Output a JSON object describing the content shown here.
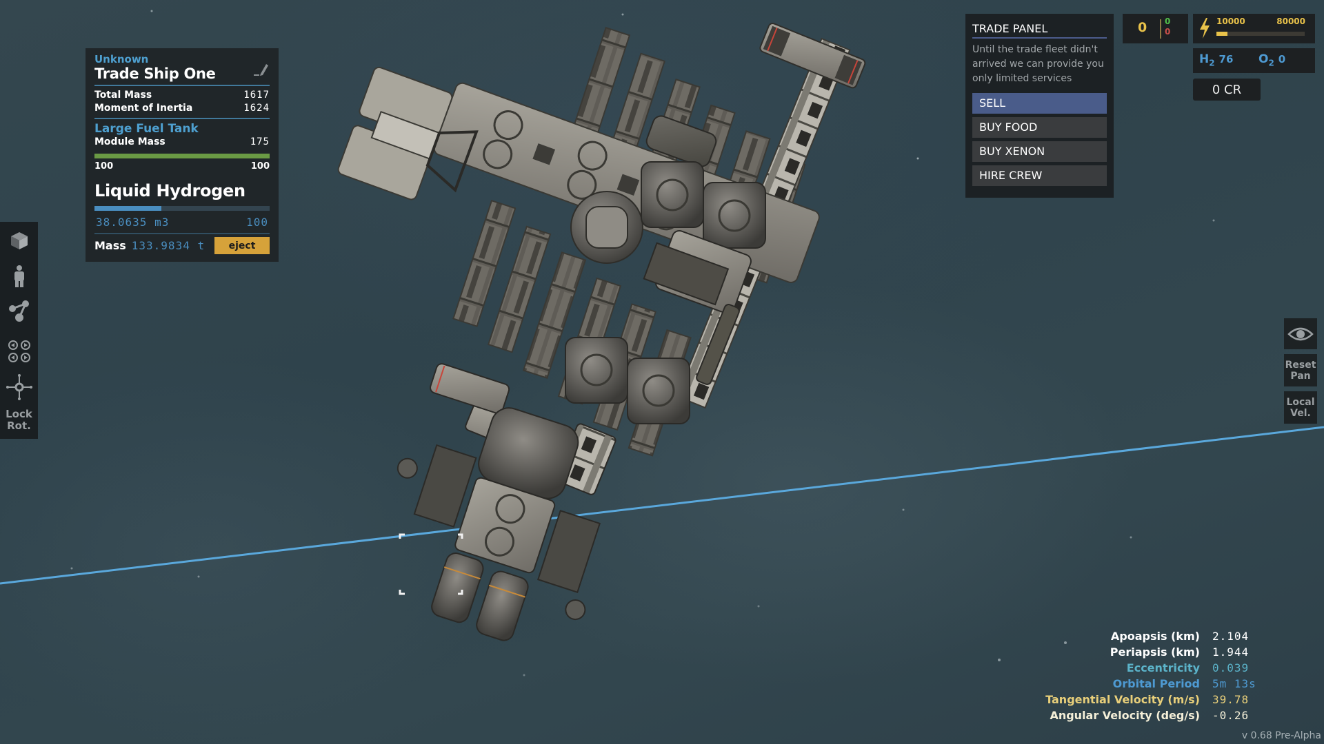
{
  "info_panel": {
    "category": "Unknown",
    "ship_name": "Trade Ship One",
    "edit_icon": "pencil-icon",
    "stats": [
      {
        "label": "Total Mass",
        "value": "1617"
      },
      {
        "label": "Moment of Inertia",
        "value": "1624"
      }
    ],
    "module": {
      "name": "Large Fuel Tank",
      "mass_label": "Module Mass",
      "mass_value": "175",
      "health_fraction": 1.0,
      "health_current": "100",
      "health_max": "100",
      "health_color": "#6a9a44"
    },
    "resource": {
      "name": "Liquid Hydrogen",
      "fill_fraction": 0.380635,
      "fill_color": "#4a8ec0",
      "volume": "38.0635 m3",
      "capacity": "100",
      "mass_label": "Mass",
      "mass_value": "133.9834 t",
      "eject_label": "eject"
    }
  },
  "left_toolbar": {
    "items": [
      {
        "icon": "cube-icon"
      },
      {
        "icon": "crew-person-icon"
      },
      {
        "icon": "node-graph-icon"
      },
      {
        "icon": "thruster-arrows-icon"
      },
      {
        "icon": "crosshair-icon"
      }
    ],
    "lock_rot_line1": "Lock",
    "lock_rot_line2": "Rot."
  },
  "trade_panel": {
    "title": "TRADE PANEL",
    "description": "Until the trade fleet didn't arrived we can provide you only limited services",
    "buttons": [
      {
        "label": "SELL",
        "active": true
      },
      {
        "label": "BUY FOOD",
        "active": false
      },
      {
        "label": "BUY XENON",
        "active": false
      },
      {
        "label": "HIRE CREW",
        "active": false
      }
    ]
  },
  "resources": {
    "counter": {
      "value": "0",
      "up": "0",
      "down": "0"
    },
    "energy": {
      "icon": "lightning-icon",
      "current": "10000",
      "max": "80000",
      "fill_fraction": 0.125
    },
    "h2": {
      "label": "H",
      "sub": "2",
      "value": "76"
    },
    "o2": {
      "label": "O",
      "sub": "2",
      "value": "0"
    },
    "credits": "0 CR"
  },
  "right_toolbar": {
    "eye_icon": "eye-icon",
    "reset_pan_line1": "Reset",
    "reset_pan_line2": "Pan",
    "local_vel_line1": "Local",
    "local_vel_line2": "Vel."
  },
  "orbit_stats": [
    {
      "label": "Apoapsis (km)",
      "value": "2.104",
      "color": "#ffffff"
    },
    {
      "label": "Periapsis (km)",
      "value": "1.944",
      "color": "#ffffff"
    },
    {
      "label": "Eccentricity",
      "value": "0.039",
      "color": "#5bb3c9"
    },
    {
      "label": "Orbital Period",
      "value": "5m 13s",
      "color": "#4e9ad2"
    },
    {
      "label": "Tangential Velocity (m/s)",
      "value": "39.78",
      "color": "#e8cf7a"
    },
    {
      "label": "Angular Velocity (deg/s)",
      "value": "-0.26",
      "color": "#f4efd8"
    }
  ],
  "version": "v 0.68 Pre-Alpha",
  "colors": {
    "accent_blue": "#4ea0d0",
    "trade_active": "#4a5c8a",
    "eject": "#d6a23a",
    "energy": "#e8c24a",
    "orbit_line": "#5aa8dc"
  }
}
